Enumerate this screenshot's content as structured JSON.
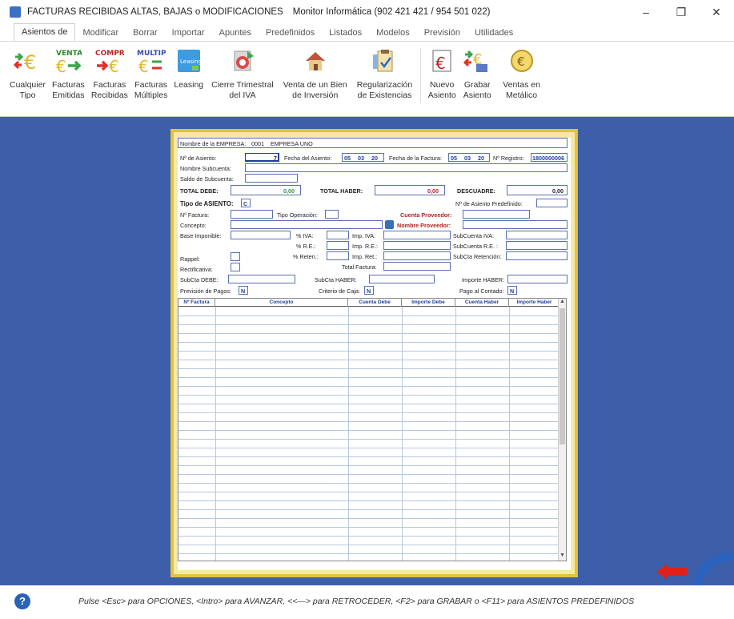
{
  "window": {
    "title": "FACTURAS RECIBIDAS ALTAS, BAJAS o MODIFICACIONES",
    "subtitle": "Monitor Informática (902 421 421 / 954 501 022)",
    "minimize": "–",
    "maximize": "❐",
    "close": "✕"
  },
  "tabs": [
    "Asientos de",
    "Modificar",
    "Borrar",
    "Importar",
    "Apuntes",
    "Predefinidos",
    "Listados",
    "Modelos",
    "Previsión",
    "Utilidades"
  ],
  "ribbon": [
    {
      "label1": "Cualquier",
      "label2": "Tipo",
      "icon": "euro-arrows-icon"
    },
    {
      "label1": "Facturas",
      "label2": "Emitidas",
      "icon": "ventas-icon",
      "tag": "VENTAS"
    },
    {
      "label1": "Facturas",
      "label2": "Recibidas",
      "icon": "compras-icon",
      "tag": "COMPRAS"
    },
    {
      "label1": "Facturas",
      "label2": "Múltiples",
      "icon": "multiple-icon",
      "tag": "MULTIPLE"
    },
    {
      "label1": "Leasing",
      "label2": "",
      "icon": "leasing-icon",
      "tag": "Leasing"
    },
    {
      "label1": "Cierre Trimestral",
      "label2": "del IVA",
      "icon": "cierre-icon"
    },
    {
      "label1": "Venta de un Bien",
      "label2": "de Inversión",
      "icon": "house-icon"
    },
    {
      "label1": "Regularización",
      "label2": "de Existencias",
      "icon": "clipboard-icon"
    },
    {
      "label1": "Nuevo",
      "label2": "Asiento",
      "icon": "new-entry-icon"
    },
    {
      "label1": "Grabar",
      "label2": "Asiento",
      "icon": "save-entry-icon"
    },
    {
      "label1": "Ventas en",
      "label2": "Metálico",
      "icon": "euro-coin-icon"
    }
  ],
  "form": {
    "empresa_label": "Nombre de la EMPRESA:",
    "empresa_code": "0001",
    "empresa_name": "EMPRESA UNO",
    "asiento_label": "Nº de Asiento:",
    "asiento_value": "7",
    "fecha_asiento_label": "Fecha del Asiento:",
    "fecha_asiento_d": "05",
    "fecha_asiento_m": "03",
    "fecha_asiento_y": "20",
    "fecha_factura_label": "Fecha de la Factura:",
    "fecha_factura_d": "05",
    "fecha_factura_m": "03",
    "fecha_factura_y": "20",
    "registro_label": "Nº Registro:",
    "registro_value": "1800000006",
    "nombre_subcuenta_label": "Nombre Subcuenta:",
    "saldo_subcuenta_label": "Saldo de Subcuenta:",
    "total_debe_label": "TOTAL DEBE:",
    "total_debe_value": "0,00",
    "total_haber_label": "TOTAL HABER:",
    "total_haber_value": "0,00",
    "descuadre_label": "DESCUADRE:",
    "descuadre_value": "0,00",
    "tipo_asiento_label": "Tipo de ASIENTO:",
    "tipo_asiento_value": "C",
    "asiento_predef_label": "Nº de Asiento Predefinido:",
    "factura_label": "Nº Factura:",
    "tipo_operacion_label": "Tipo Operación:",
    "cuenta_proveedor_label": "Cuenta Proveedor:",
    "concepto_label": "Concepto:",
    "nombre_proveedor_label": "Nombre Proveedor:",
    "base_imponible_label": "Base Imponible:",
    "iva_pct_label": "% IVA:",
    "imp_iva_label": "Imp. IVA:",
    "subcuenta_iva_label": "SubCuenta IVA:",
    "re_pct_label": "% R.E.:",
    "imp_re_label": "Imp. R.E.:",
    "subcuenta_re_label": "SubCuenta R.E. :",
    "reten_pct_label": "% Reten.:",
    "imp_ret_label": "Imp. Ret.:",
    "subcta_retencion_label": "SubCta Retención:",
    "rappel_label": "Rappel:",
    "total_factura_label": "Total Factura:",
    "rectificativa_label": "Rectificativa:",
    "subcta_debe_label": "SubCta DEBE:",
    "subcta_haber_label": "SubCta HABER:",
    "importe_haber_label": "Importe HABER:",
    "prevision_label": "Previsión de Pagos:",
    "prevision_value": "N",
    "criterio_label": "Criterio de Caja:",
    "criterio_value": "N",
    "pago_contado_label": "Pago al Contado:",
    "pago_contado_value": "N"
  },
  "table": {
    "columns": [
      "Nº Factura",
      "Concepto",
      "Cuenta Debe",
      "Importe Debe",
      "Cuenta Haber",
      "Importe Haber"
    ]
  },
  "status": {
    "help": "?",
    "text": "Pulse <Esc> para OPCIONES, <Intro> para AVANZAR, <<—> para RETROCEDER, <F2> para GRABAR o <F11> para ASIENTOS PREDEFINIDOS"
  },
  "colors": {
    "desktop": "#3d5ea8",
    "form_border": "#e2c23f",
    "label_red": "#b52020",
    "label_blue": "#1c3f9e"
  }
}
